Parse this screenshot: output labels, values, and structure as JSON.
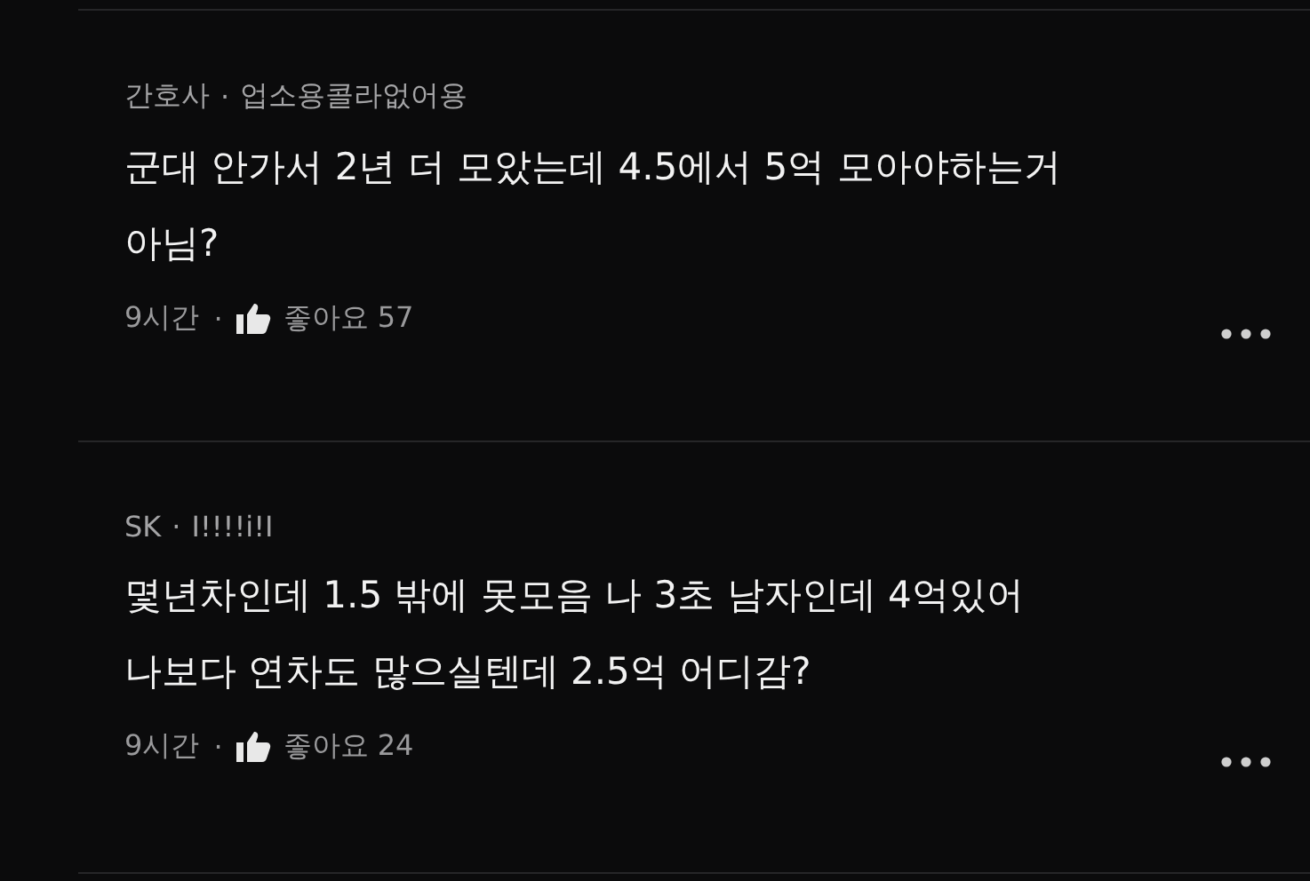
{
  "comments": [
    {
      "author": "간호사",
      "head_separator": "·",
      "nickname": "업소용콜라없어용",
      "lines": [
        "군대 안가서 2년 더 모았는데 4.5에서 5억 모아야하는거",
        "아님?"
      ],
      "time": "9시간",
      "meta_separator": "·",
      "like_label": "좋아요",
      "likes": "57"
    },
    {
      "author": "SK",
      "head_separator": "·",
      "nickname": "I!!!!i!I",
      "lines": [
        "몇년차인데 1.5 밖에 못모음 나 3초 남자인데 4억있어",
        "나보다 연차도 많으실텐데 2.5억 어디감?"
      ],
      "time": "9시간",
      "meta_separator": "·",
      "like_label": "좋아요",
      "likes": "24"
    }
  ]
}
